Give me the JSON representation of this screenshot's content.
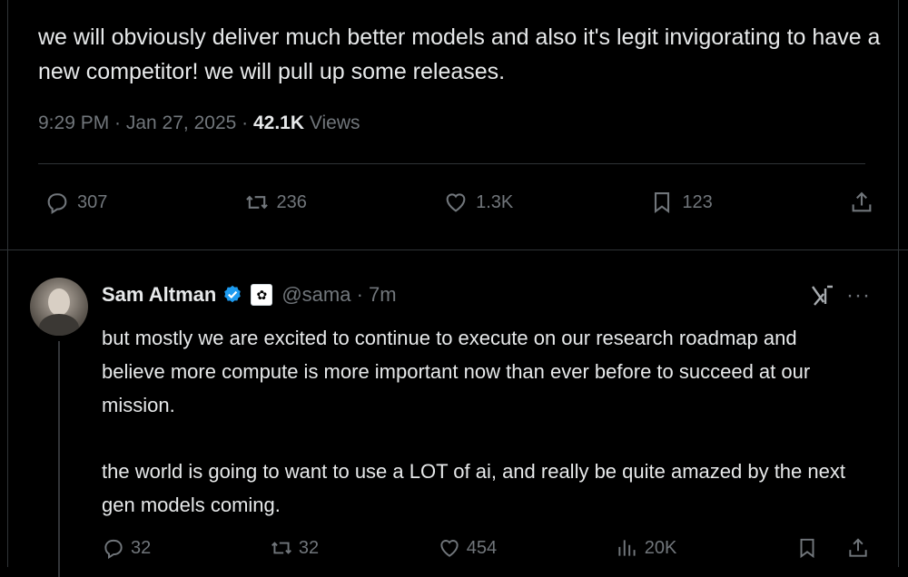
{
  "tweet": {
    "text": "we will obviously deliver much better models and also it's legit invigorating to have a new competitor! we will pull up some releases.",
    "time": "9:29 PM · Jan 27, 2025 · ",
    "views_count": "42.1K",
    "views_label": " Views",
    "actions": {
      "replies": "307",
      "reposts": "236",
      "likes": "1.3K",
      "bookmarks": "123"
    }
  },
  "reply": {
    "name": "Sam Altman",
    "handle": "@sama · 7m",
    "paragraph1": "but mostly we are excited to continue to execute on our research roadmap and believe more compute is more important now than ever before to succeed at our mission.",
    "paragraph2": "the world is going to want to use a LOT of ai, and really be quite amazed by the next gen models coming.",
    "actions": {
      "replies": "32",
      "reposts": "32",
      "likes": "454",
      "views": "20K"
    },
    "more": "···"
  },
  "colors": {
    "background": "#000000",
    "text": "#e7e9ea",
    "muted": "#71767b",
    "verified": "#1d9bf0",
    "divider": "#2f3336"
  },
  "icons": [
    "reply-icon",
    "repost-icon",
    "like-icon",
    "bookmark-icon",
    "share-icon",
    "verified-badge-icon",
    "grok-icon",
    "more-icon",
    "views-icon"
  ]
}
